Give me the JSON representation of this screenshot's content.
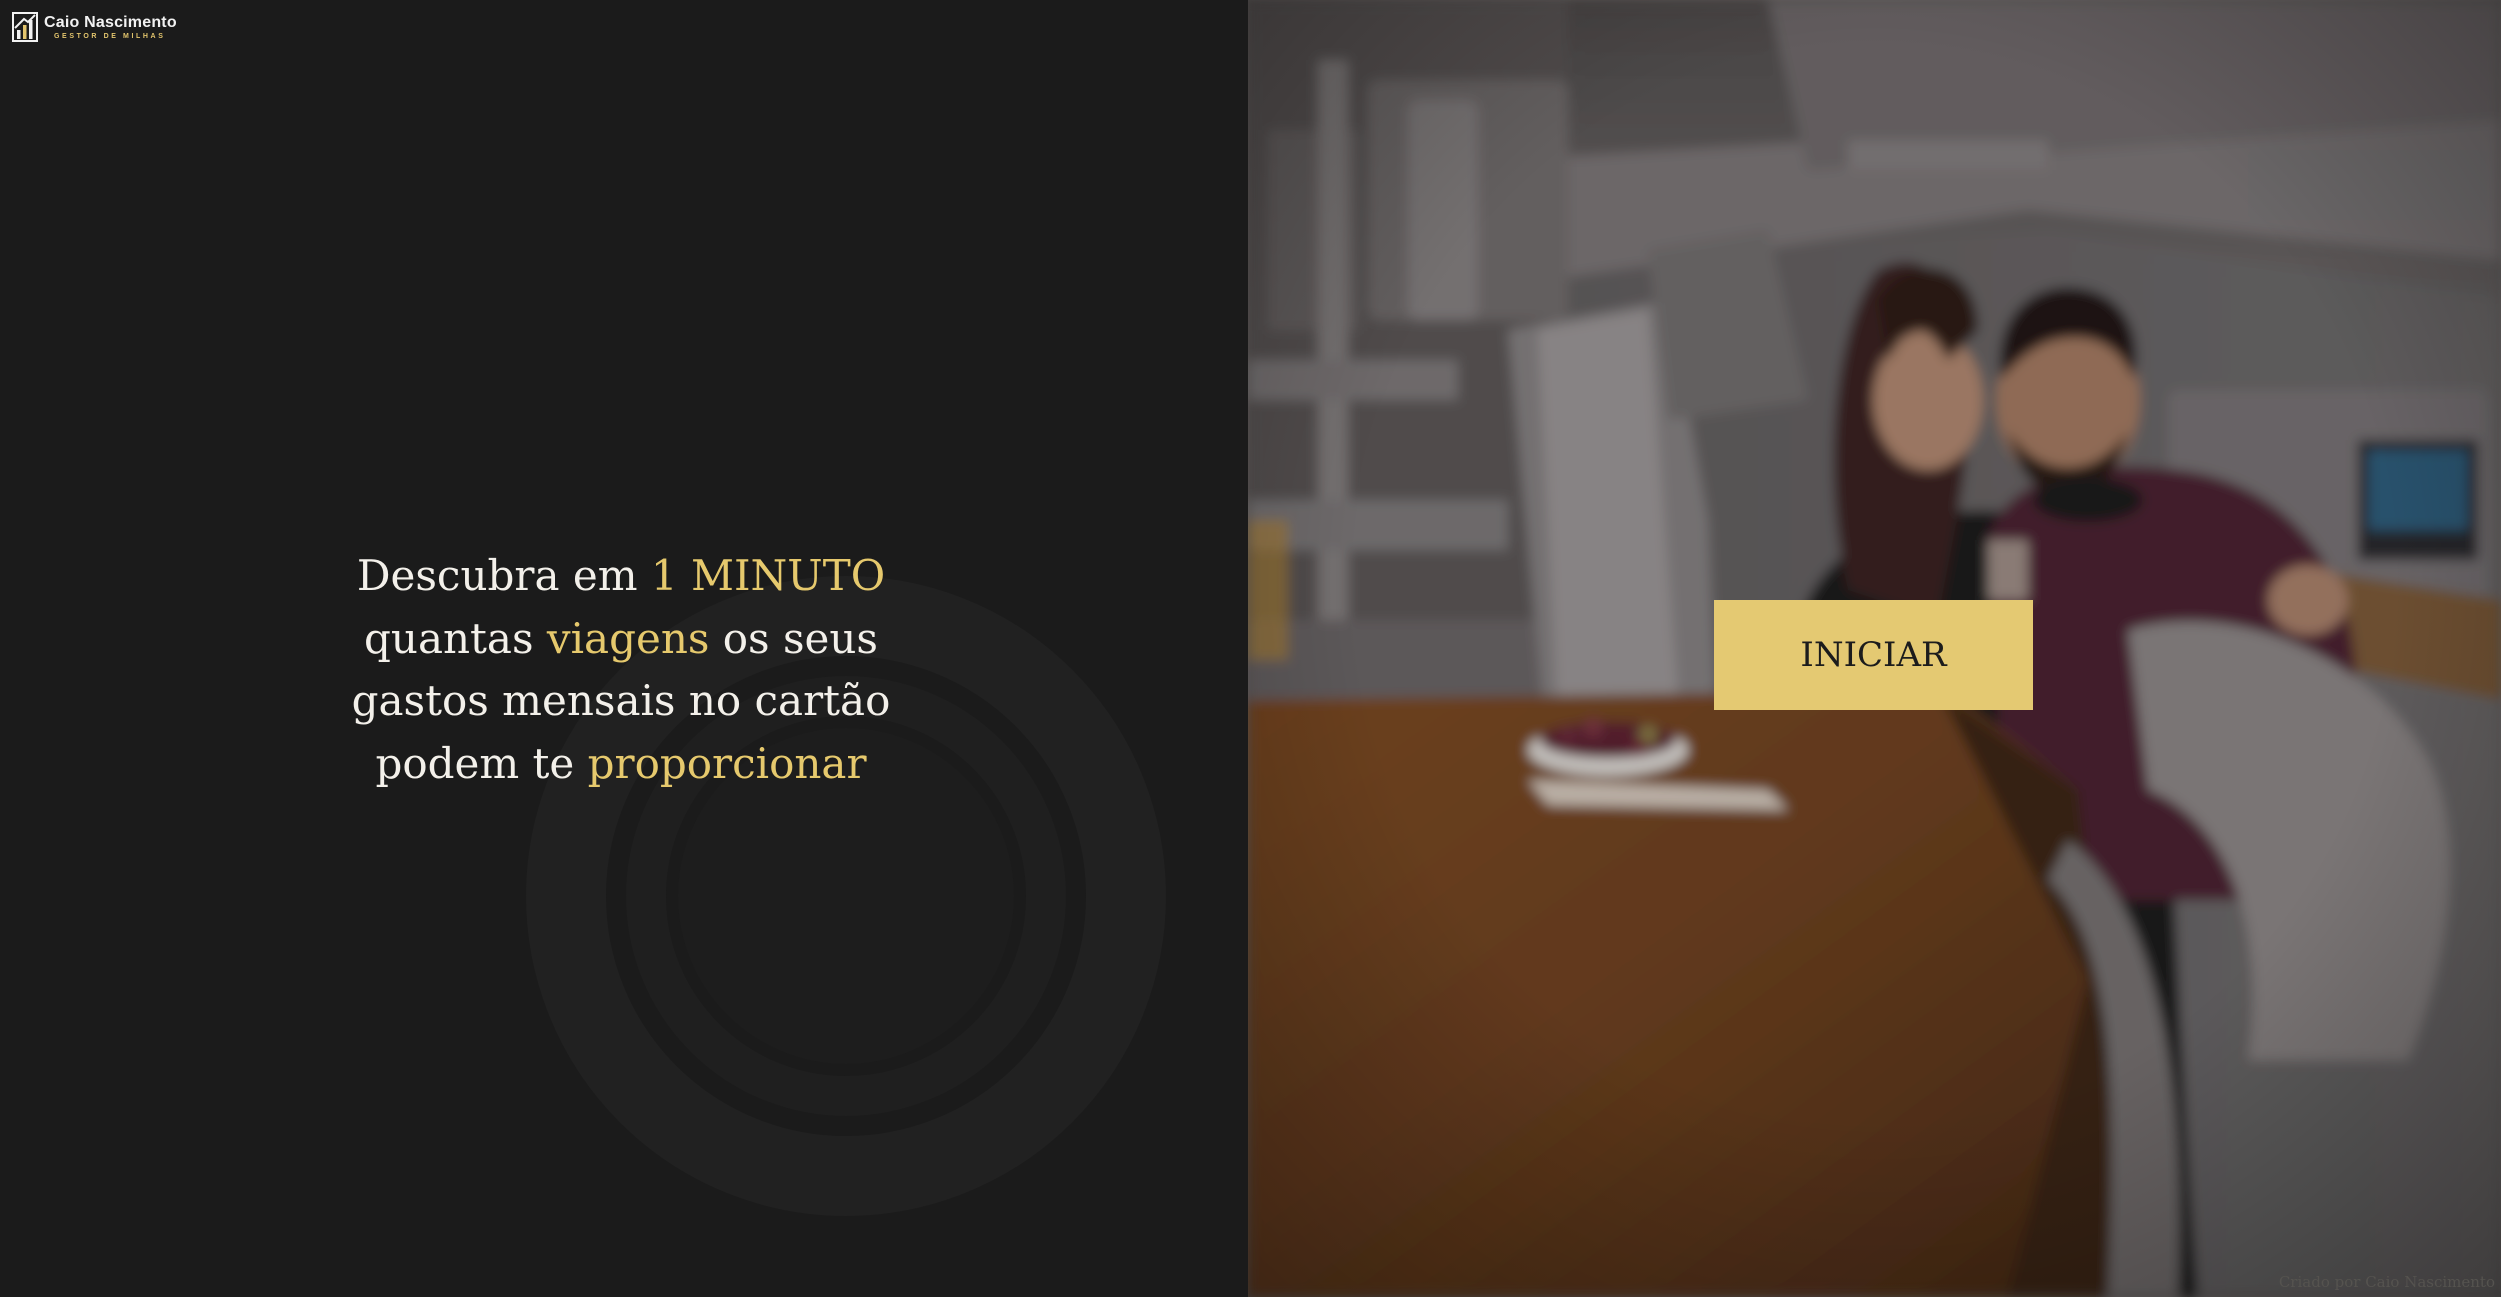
{
  "brand": {
    "name": "Caio Nascimento",
    "tagline": "GESTOR DE MILHAS",
    "logo_icon": "chart-bars-logo-icon"
  },
  "hero": {
    "line1_a": "Descubra em ",
    "line1_highlight": "1 MINUTO",
    "line2_a": "quantas ",
    "line2_highlight": "viagens",
    "line2_b": " os seus",
    "line3": "gastos mensais no cartão",
    "line4_a": "podem te ",
    "line4_highlight": "proporcionar"
  },
  "cta": {
    "label": "INICIAR"
  },
  "footer": {
    "credit": "Criado por Caio Nascimento"
  },
  "colors": {
    "background": "#1b1b1b",
    "accent": "#e4c972",
    "text": "#f3f0ea"
  }
}
